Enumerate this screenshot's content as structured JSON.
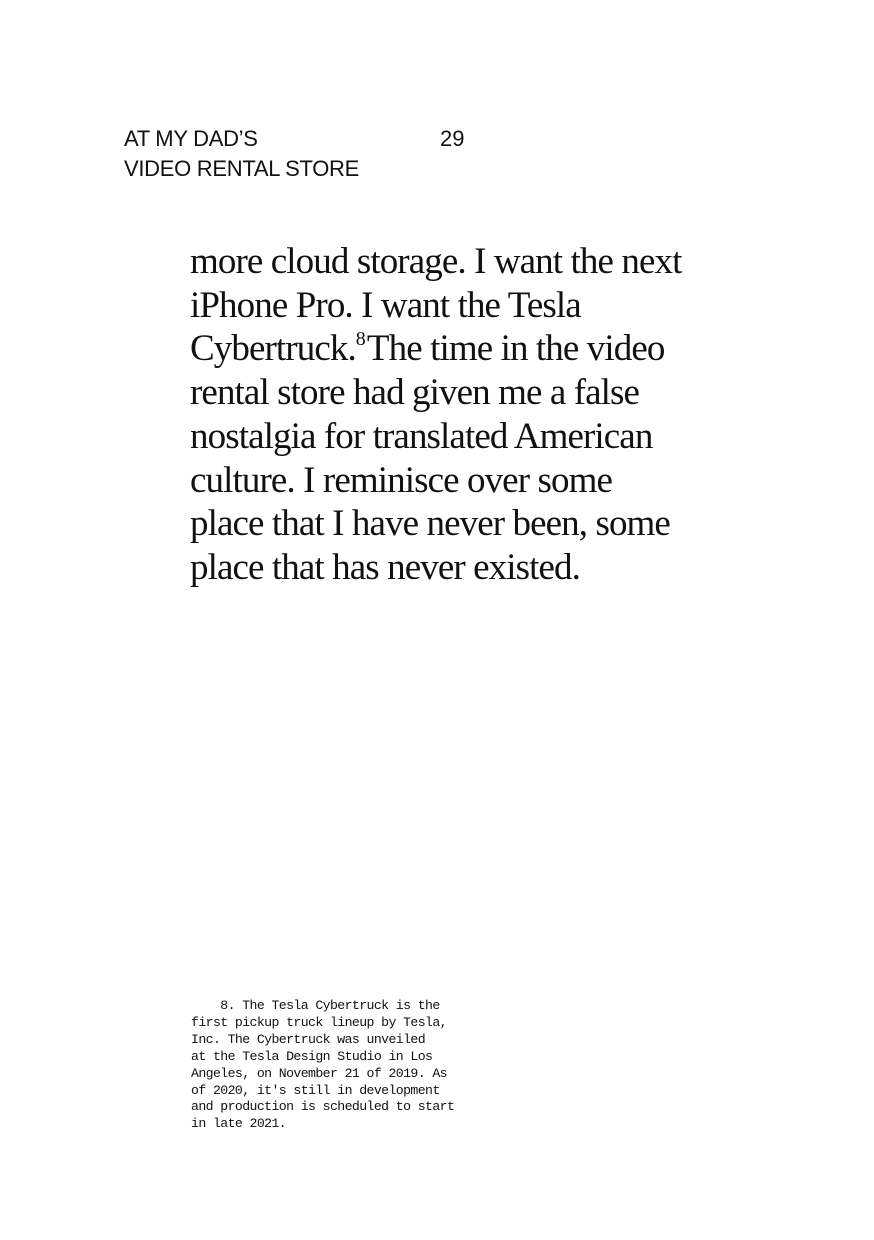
{
  "header": {
    "title_line_1": "AT MY DAD’S",
    "title_line_2": "VIDEO RENTAL STORE",
    "page_number": "29"
  },
  "body": {
    "lines": [
      "more cloud storage. I want the next",
      "iPhone Pro. I want the Tesla",
      "Cybertruck.",
      "The time in the video",
      "rental store had given me a false",
      "nostalgia for translated American",
      "culture. I reminisce over some",
      "place that I have never been, some",
      "place that has never existed."
    ],
    "footnote_ref": "8"
  },
  "footnote": {
    "lines": [
      "    8. The Tesla Cybertruck is the",
      "first pickup truck lineup by Tesla,",
      "Inc. The Cybertruck was unveiled",
      "at the Tesla Design Studio in Los",
      "Angeles, on November 21 of 2019. As",
      "of 2020, it's still in development",
      "and production is scheduled to start",
      "in late 2021."
    ]
  }
}
